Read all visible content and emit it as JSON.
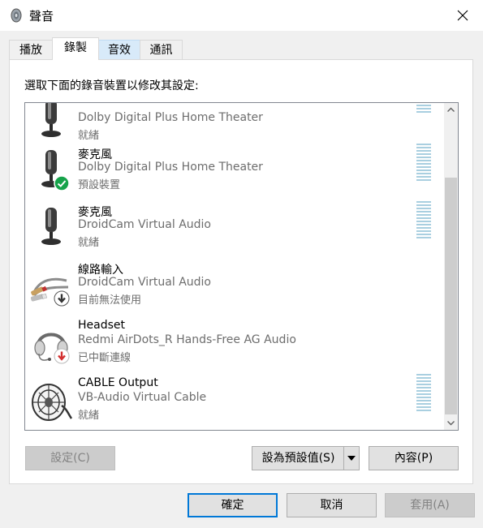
{
  "window": {
    "title": "聲音",
    "app_icon": "speaker-icon",
    "close_icon": "close-icon"
  },
  "tabs": [
    {
      "label": "播放",
      "state": "normal"
    },
    {
      "label": "錄製",
      "state": "active"
    },
    {
      "label": "音效",
      "state": "hover"
    },
    {
      "label": "通訊",
      "state": "normal"
    }
  ],
  "instruction": "選取下面的錄音裝置以修改其設定:",
  "devices": [
    {
      "name": "",
      "description": "Dolby Digital Plus Home Theater",
      "status": "就緒",
      "icon": "microphone-icon",
      "badge": ""
    },
    {
      "name": "麥克風",
      "description": "Dolby Digital Plus Home Theater",
      "status": "預設裝置",
      "icon": "microphone-icon",
      "badge": "default-checkmark-icon"
    },
    {
      "name": "麥克風",
      "description": "DroidCam Virtual Audio",
      "status": "就緒",
      "icon": "microphone-icon",
      "badge": ""
    },
    {
      "name": "線路輸入",
      "description": "DroidCam Virtual Audio",
      "status": "目前無法使用",
      "icon": "line-in-cable-icon",
      "badge": "unavailable-arrow-icon"
    },
    {
      "name": "Headset",
      "description": "Redmi AirDots_R Hands-Free AG Audio",
      "status": "已中斷連線",
      "icon": "headset-icon",
      "badge": "disconnected-arrow-icon"
    },
    {
      "name": "CABLE Output",
      "description": "VB-Audio Virtual Cable",
      "status": "就緒",
      "icon": "virtual-cable-icon",
      "badge": ""
    }
  ],
  "buttons": {
    "configure": "設定(C)",
    "set_default": "設為預設值(S)",
    "properties": "內容(P)",
    "ok": "確定",
    "cancel": "取消",
    "apply": "套用(A)"
  },
  "colors": {
    "accent": "#0078d7",
    "ok_badge": "#16a34a",
    "disconnected_badge": "#d32f2f",
    "meter": "#a9cfe0"
  }
}
